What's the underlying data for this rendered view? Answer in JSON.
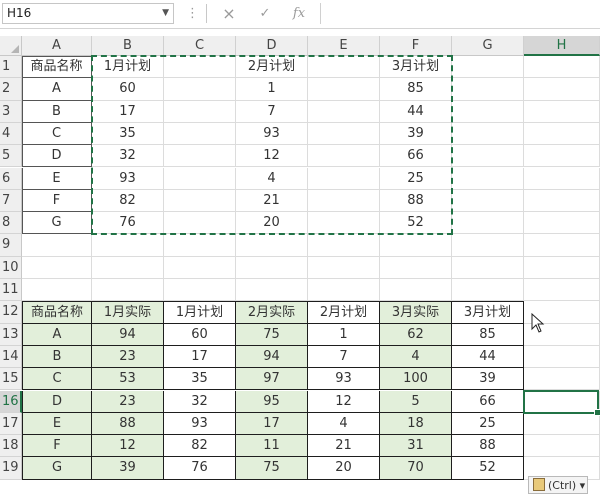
{
  "formula_bar": {
    "name_box": "H16",
    "cancel_icon": "×",
    "enter_icon": "✓",
    "fx_label": "fx",
    "more_icon": "⋮",
    "formula": ""
  },
  "columns": [
    "A",
    "B",
    "C",
    "D",
    "E",
    "F",
    "G",
    "H"
  ],
  "selected_column": "H",
  "rows": [
    "1",
    "2",
    "3",
    "4",
    "5",
    "6",
    "7",
    "8",
    "9",
    "10",
    "11",
    "12",
    "13",
    "14",
    "15",
    "16",
    "17",
    "18",
    "19"
  ],
  "selected_row": "16",
  "top_table": {
    "header": [
      "商品名称",
      "1月计划",
      "",
      "2月计划",
      "",
      "3月计划"
    ],
    "rows": [
      [
        "A",
        "60",
        "",
        "1",
        "",
        "85"
      ],
      [
        "B",
        "17",
        "",
        "7",
        "",
        "44"
      ],
      [
        "C",
        "35",
        "",
        "93",
        "",
        "39"
      ],
      [
        "D",
        "32",
        "",
        "12",
        "",
        "66"
      ],
      [
        "E",
        "93",
        "",
        "4",
        "",
        "25"
      ],
      [
        "F",
        "82",
        "",
        "21",
        "",
        "88"
      ],
      [
        "G",
        "76",
        "",
        "20",
        "",
        "52"
      ]
    ]
  },
  "bottom_table": {
    "header": [
      "商品名称",
      "1月实际",
      "1月计划",
      "2月实际",
      "2月计划",
      "3月实际",
      "3月计划"
    ],
    "rows": [
      [
        "A",
        "94",
        "60",
        "75",
        "1",
        "62",
        "85"
      ],
      [
        "B",
        "23",
        "17",
        "94",
        "7",
        "4",
        "44"
      ],
      [
        "C",
        "53",
        "35",
        "97",
        "93",
        "100",
        "39"
      ],
      [
        "D",
        "23",
        "32",
        "95",
        "12",
        "5",
        "66"
      ],
      [
        "E",
        "88",
        "93",
        "17",
        "4",
        "18",
        "25"
      ],
      [
        "F",
        "12",
        "82",
        "11",
        "21",
        "31",
        "88"
      ],
      [
        "G",
        "39",
        "76",
        "75",
        "20",
        "70",
        "52"
      ]
    ]
  },
  "paste_options": {
    "label": "(Ctrl) ▾"
  },
  "colors": {
    "accent": "#217346",
    "green_fill": "#e2efda"
  }
}
